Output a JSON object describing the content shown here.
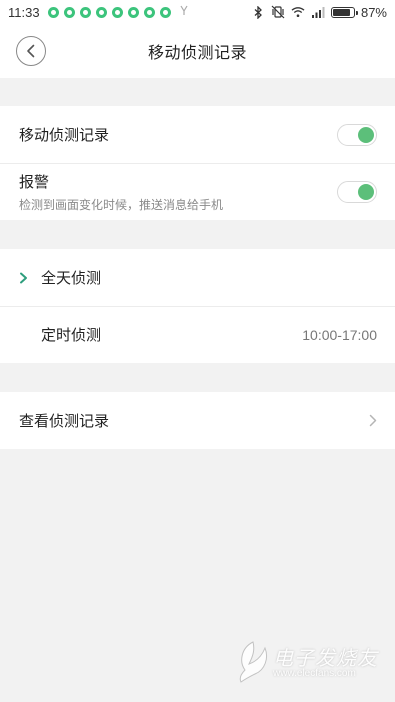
{
  "status_bar": {
    "time": "11:33",
    "notification_count": 8,
    "battery_percent": "87%",
    "battery_level": 0.87
  },
  "header": {
    "title": "移动侦测记录"
  },
  "settings": {
    "motion_detect": {
      "label": "移动侦测记录",
      "enabled": true
    },
    "alarm": {
      "label": "报警",
      "description": "检测到画面变化时候，推送消息给手机",
      "enabled": true
    }
  },
  "modes": {
    "all_day": {
      "label": "全天侦测",
      "selected": true
    },
    "scheduled": {
      "label": "定时侦测",
      "value": "10:00-17:00",
      "selected": false
    }
  },
  "records": {
    "label": "查看侦测记录"
  },
  "watermark": {
    "text": "电子发烧友",
    "url": "www.elecfans.com"
  },
  "colors": {
    "accent_green": "#2e9e7d",
    "toggle_green": "#5cbf7a",
    "notif_green": "#3cc47c"
  }
}
